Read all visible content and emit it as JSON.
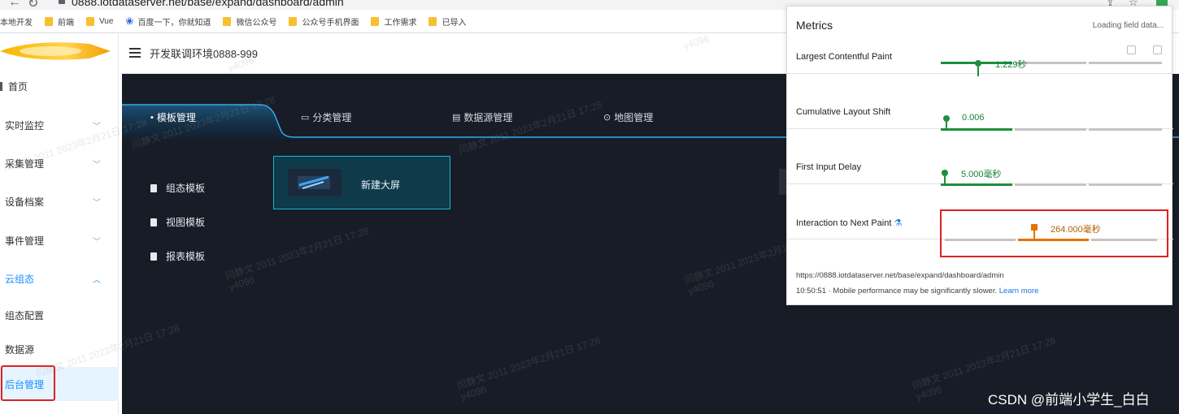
{
  "browser": {
    "url": "0888.iotdataserver.net/base/expand/dashboard/admin",
    "bookmarks": [
      {
        "label": "本地开发",
        "icon": "none"
      },
      {
        "label": "前端",
        "icon": "folder-icon"
      },
      {
        "label": "Vue",
        "icon": "folder-icon"
      },
      {
        "label": "百度一下，你就知道",
        "icon": "baidu-paw-icon"
      },
      {
        "label": "微信公众号",
        "icon": "folder-icon"
      },
      {
        "label": "公众号手机界面",
        "icon": "folder-icon"
      },
      {
        "label": "工作需求",
        "icon": "folder-icon"
      },
      {
        "label": "已导入",
        "icon": "folder-icon"
      }
    ]
  },
  "header": {
    "title": "开发联调环境0888-999"
  },
  "sidebar": {
    "items": [
      {
        "label": "首页",
        "chevron": ""
      },
      {
        "label": "实时监控",
        "chevron": "﹀"
      },
      {
        "label": "采集管理",
        "chevron": "﹀"
      },
      {
        "label": "设备档案",
        "chevron": "﹀"
      },
      {
        "label": "事件管理",
        "chevron": "﹀"
      },
      {
        "label": "云组态",
        "chevron": "︿"
      },
      {
        "label": "组态配置",
        "chevron": ""
      },
      {
        "label": "数据源",
        "chevron": ""
      },
      {
        "label": "后台管理",
        "chevron": ""
      }
    ]
  },
  "tabs": [
    {
      "label": "模板管理",
      "icon": "grid-icon",
      "glyph": "▪"
    },
    {
      "label": "分类管理",
      "icon": "folder-outline-icon",
      "glyph": "▭"
    },
    {
      "label": "数据源管理",
      "icon": "database-icon",
      "glyph": "▤"
    },
    {
      "label": "地图管理",
      "icon": "map-pin-icon",
      "glyph": "⊙"
    }
  ],
  "subnav": [
    {
      "label": "组态模板"
    },
    {
      "label": "视图模板"
    },
    {
      "label": "报表模板"
    }
  ],
  "new_screen": {
    "label": "新建大屏"
  },
  "metrics": {
    "title": "Metrics",
    "loading": "Loading field data...",
    "rows": [
      {
        "name": "Largest Contentful Paint",
        "value": "1.229秒",
        "level": "good"
      },
      {
        "name": "Cumulative Layout Shift",
        "value": "0.006",
        "level": "good"
      },
      {
        "name": "First Input Delay",
        "value": "5.000毫秒",
        "level": "good"
      },
      {
        "name": "Interaction to Next Paint",
        "value": "264.000毫秒",
        "level": "needs-improvement"
      }
    ],
    "url": "https://0888.iotdataserver.net/base/expand/dashboard/admin",
    "footer_time": "10:50:51 · Mobile performance may be significantly slower.",
    "learn_more": "Learn more"
  },
  "watermark": {
    "line1": "闫静文 2011 2023年2月21日 17:28",
    "line2": "y4096"
  },
  "overlay_credit": "CSDN @前端小学生_白白",
  "colors": {
    "good": "#1e8e3e",
    "needs_improvement": "#e37400",
    "accent_blue": "#1890ff",
    "main_bg": "#171c26",
    "highlight_red": "#e02020"
  }
}
